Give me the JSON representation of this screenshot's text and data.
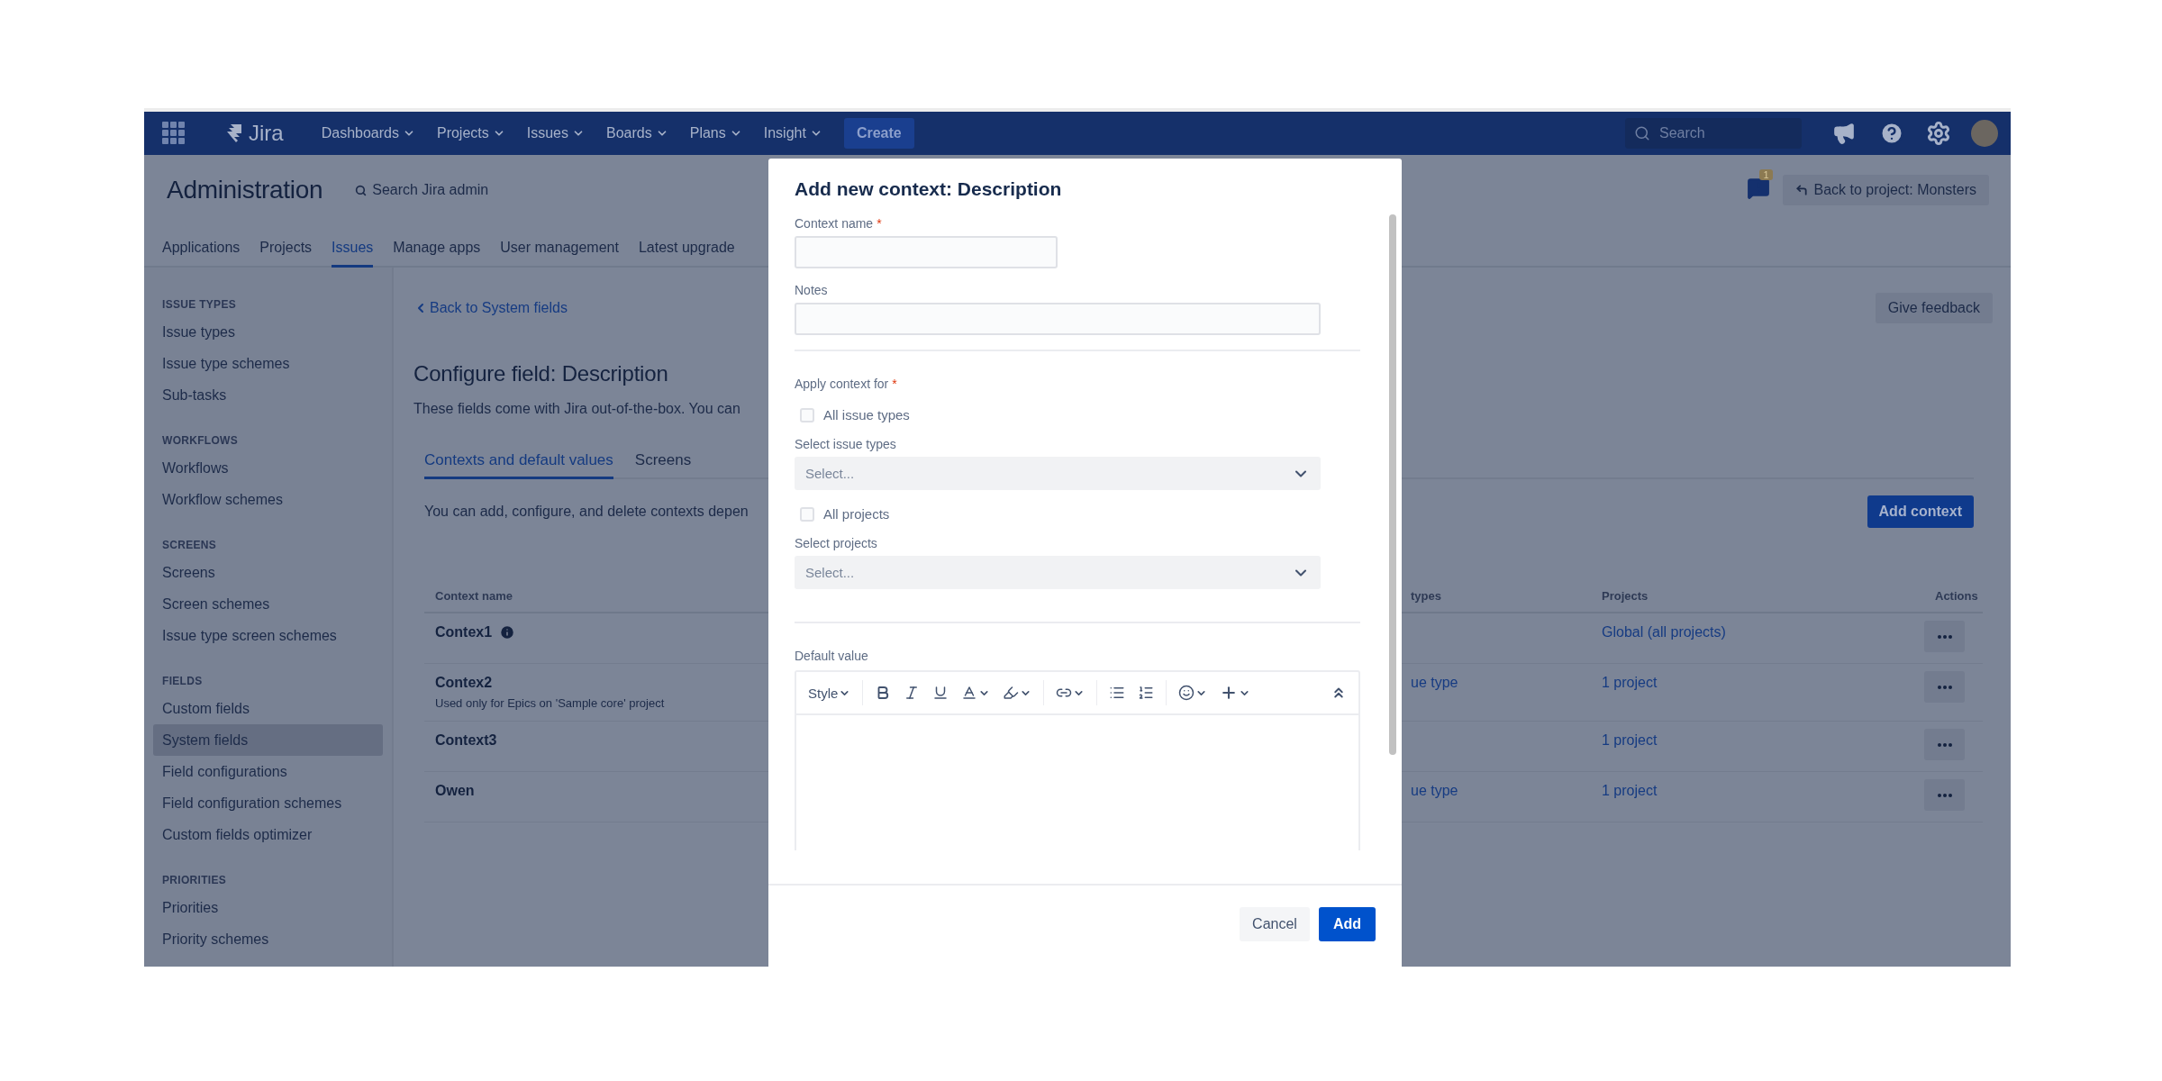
{
  "nav": {
    "logo": "Jira",
    "items": [
      {
        "label": "Dashboards"
      },
      {
        "label": "Projects"
      },
      {
        "label": "Issues"
      },
      {
        "label": "Boards"
      },
      {
        "label": "Plans"
      },
      {
        "label": "Insight"
      }
    ],
    "create": "Create",
    "search": {
      "placeholder": "Search"
    }
  },
  "admin": {
    "title": "Administration",
    "search": "Search Jira admin",
    "notification_count": "1",
    "back_button": "Back to project: Monsters",
    "tabs": [
      {
        "label": "Applications",
        "selected": false
      },
      {
        "label": "Projects",
        "selected": false
      },
      {
        "label": "Issues",
        "selected": true
      },
      {
        "label": "Manage apps",
        "selected": false
      },
      {
        "label": "User management",
        "selected": false
      },
      {
        "label": "Latest upgrade",
        "selected": false
      }
    ]
  },
  "sidebar": {
    "sections": [
      {
        "heading": "ISSUE TYPES",
        "items": [
          {
            "label": "Issue types",
            "selected": false
          },
          {
            "label": "Issue type schemes",
            "selected": false
          },
          {
            "label": "Sub-tasks",
            "selected": false
          }
        ]
      },
      {
        "heading": "WORKFLOWS",
        "items": [
          {
            "label": "Workflows",
            "selected": false
          },
          {
            "label": "Workflow schemes",
            "selected": false
          }
        ]
      },
      {
        "heading": "SCREENS",
        "items": [
          {
            "label": "Screens",
            "selected": false
          },
          {
            "label": "Screen schemes",
            "selected": false
          },
          {
            "label": "Issue type screen schemes",
            "selected": false
          }
        ]
      },
      {
        "heading": "FIELDS",
        "items": [
          {
            "label": "Custom fields",
            "selected": false
          },
          {
            "label": "System fields",
            "selected": true
          },
          {
            "label": "Field configurations",
            "selected": false
          },
          {
            "label": "Field configuration schemes",
            "selected": false
          },
          {
            "label": "Custom fields optimizer",
            "selected": false
          }
        ]
      },
      {
        "heading": "PRIORITIES",
        "items": [
          {
            "label": "Priorities",
            "selected": false
          },
          {
            "label": "Priority schemes",
            "selected": false
          }
        ]
      }
    ]
  },
  "main": {
    "back_link": "Back to System fields",
    "feedback_button": "Give feedback",
    "title": "Configure field: Description",
    "description": "These fields come with Jira out-of-the-box. You can",
    "tabs": [
      {
        "label": "Contexts and default values",
        "selected": true
      },
      {
        "label": "Screens",
        "selected": false
      }
    ],
    "info": "You can add, configure, and delete contexts depen",
    "add_button": "Add context",
    "table": {
      "columns": [
        "Context name",
        "types",
        "Projects",
        "Actions"
      ],
      "rows": [
        {
          "name": "Contex1",
          "info": true,
          "projects": "Global (all projects)"
        },
        {
          "name": "Contex2",
          "info": false,
          "note": "Used only for Epics on 'Sample core' project",
          "issue_types": "ue type",
          "projects": "1 project"
        },
        {
          "name": "Context3",
          "info": false,
          "projects": "1 project"
        },
        {
          "name": "Owen",
          "info": false,
          "issue_types": "ue type",
          "projects": "1 project"
        }
      ]
    }
  },
  "modal": {
    "title": "Add new context: Description",
    "context_name": {
      "label": "Context name",
      "required_mark": "*"
    },
    "notes": {
      "label": "Notes"
    },
    "apply": {
      "label": "Apply context for",
      "required_mark": "*",
      "groups": [
        {
          "checkbox": {
            "label": "All issue types",
            "checked": false
          },
          "select": {
            "label": "Select issue types",
            "placeholder": "Select..."
          }
        },
        {
          "checkbox": {
            "label": "All projects",
            "checked": false
          },
          "select": {
            "label": "Select projects",
            "placeholder": "Select..."
          }
        }
      ]
    },
    "default_value": {
      "label": "Default value",
      "style_menu": "Style"
    },
    "buttons": {
      "cancel": "Cancel",
      "add": "Add"
    }
  }
}
